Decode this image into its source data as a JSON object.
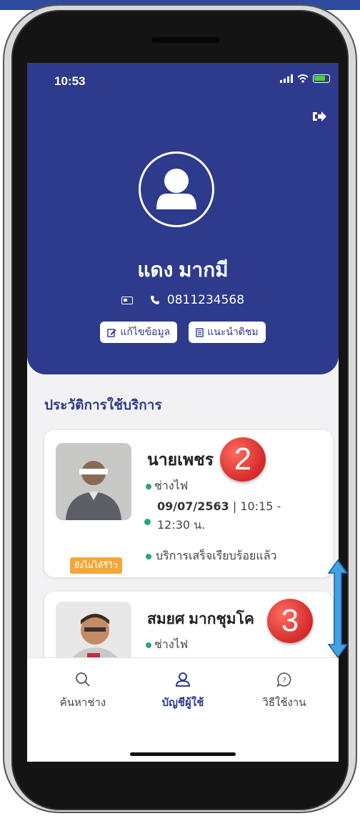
{
  "status_bar": {
    "time": "10:53"
  },
  "profile": {
    "name": "แดง มากมี",
    "phone": "0811234568",
    "edit_button": "แก้ไขข้อมูล",
    "recommend_button": "แนะนำติชม"
  },
  "history": {
    "title": "ประวัติการใช้บริการ",
    "items": [
      {
        "name": "นายเพชร",
        "type": "ช่างไฟ",
        "date": "09/07/2563",
        "time": "| 10:15 - 12:30 น.",
        "status": "บริการเสร็จเรียบร้อยแล้ว",
        "review_badge": "ยังไม่ได้รีวิว",
        "marker": "2"
      },
      {
        "name": "สมยศ มากชุมโค",
        "type": "ช่างไฟ",
        "marker": "3"
      }
    ]
  },
  "bottom_nav": {
    "items": [
      {
        "label": "ค้นหาช่าง",
        "icon": "search-icon"
      },
      {
        "label": "บัญชีผู้ใช้",
        "icon": "user-icon"
      },
      {
        "label": "วิธีใช้งาน",
        "icon": "help-icon"
      }
    ]
  },
  "colors": {
    "primary": "#2e3a8c",
    "accent": "#2fa66f",
    "badge": "#f4a63a",
    "marker": "#d42a2a",
    "arrow": "#2e8fd6"
  }
}
